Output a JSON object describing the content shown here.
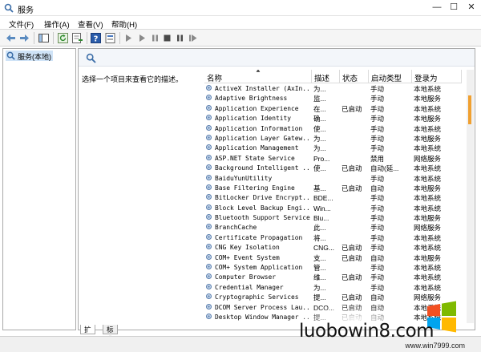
{
  "window": {
    "title": "服务",
    "minimize": "—",
    "maximize": "☐",
    "close": "✕"
  },
  "menu": [
    "文件(F)",
    "操作(A)",
    "查看(V)",
    "帮助(H)"
  ],
  "toolbar": [
    "back-icon",
    "forward-icon",
    "show-hide-tree-icon",
    "refresh-icon",
    "export-list-icon",
    "help-icon",
    "properties-icon",
    "start-service-icon",
    "start-icon",
    "pause-icon",
    "stop-icon",
    "pause-service-icon",
    "restart-icon"
  ],
  "tree": {
    "node_label": "服务(本地)"
  },
  "detail": {
    "description_prompt": "选择一个项目来查看它的描述。"
  },
  "columns": {
    "name": "名称",
    "desc": "描述",
    "status": "状态",
    "startup": "启动类型",
    "logon": "登录为"
  },
  "services": [
    {
      "name": "ActiveX Installer (AxIn...",
      "desc": "为...",
      "status": "",
      "startup": "手动",
      "logon": "本地系统"
    },
    {
      "name": "Adaptive Brightness",
      "desc": "监...",
      "status": "",
      "startup": "手动",
      "logon": "本地服务"
    },
    {
      "name": "Application Experience",
      "desc": "在...",
      "status": "已启动",
      "startup": "手动",
      "logon": "本地系统"
    },
    {
      "name": "Application Identity",
      "desc": "确...",
      "status": "",
      "startup": "手动",
      "logon": "本地服务"
    },
    {
      "name": "Application Information",
      "desc": "使...",
      "status": "",
      "startup": "手动",
      "logon": "本地系统"
    },
    {
      "name": "Application Layer Gatew...",
      "desc": "为...",
      "status": "",
      "startup": "手动",
      "logon": "本地服务"
    },
    {
      "name": "Application Management",
      "desc": "为...",
      "status": "",
      "startup": "手动",
      "logon": "本地系统"
    },
    {
      "name": "ASP.NET State Service",
      "desc": "Pro...",
      "status": "",
      "startup": "禁用",
      "logon": "网络服务"
    },
    {
      "name": "Background Intelligent ...",
      "desc": "使...",
      "status": "已启动",
      "startup": "自动(延...",
      "logon": "本地系统"
    },
    {
      "name": "BaiduYunUtility",
      "desc": "",
      "status": "",
      "startup": "手动",
      "logon": "本地系统"
    },
    {
      "name": "Base Filtering Engine",
      "desc": "基...",
      "status": "已启动",
      "startup": "自动",
      "logon": "本地服务"
    },
    {
      "name": "BitLocker Drive Encrypt...",
      "desc": "BDE...",
      "status": "",
      "startup": "手动",
      "logon": "本地系统"
    },
    {
      "name": "Block Level Backup Engi...",
      "desc": "Win...",
      "status": "",
      "startup": "手动",
      "logon": "本地系统"
    },
    {
      "name": "Bluetooth Support Service",
      "desc": "Blu...",
      "status": "",
      "startup": "手动",
      "logon": "本地服务"
    },
    {
      "name": "BranchCache",
      "desc": "此...",
      "status": "",
      "startup": "手动",
      "logon": "网络服务"
    },
    {
      "name": "Certificate Propagation",
      "desc": "将...",
      "status": "",
      "startup": "手动",
      "logon": "本地系统"
    },
    {
      "name": "CNG Key Isolation",
      "desc": "CNG...",
      "status": "已启动",
      "startup": "手动",
      "logon": "本地系统"
    },
    {
      "name": "COM+ Event System",
      "desc": "支...",
      "status": "已启动",
      "startup": "自动",
      "logon": "本地服务"
    },
    {
      "name": "COM+ System Application",
      "desc": "管...",
      "status": "",
      "startup": "手动",
      "logon": "本地系统"
    },
    {
      "name": "Computer Browser",
      "desc": "维...",
      "status": "已启动",
      "startup": "手动",
      "logon": "本地系统"
    },
    {
      "name": "Credential Manager",
      "desc": "为...",
      "status": "",
      "startup": "手动",
      "logon": "本地系统"
    },
    {
      "name": "Cryptographic Services",
      "desc": "提...",
      "status": "已启动",
      "startup": "自动",
      "logon": "网络服务"
    },
    {
      "name": "DCOM Server Process Lau...",
      "desc": "DCO...",
      "status": "已启动",
      "startup": "自动",
      "logon": "本地系统"
    },
    {
      "name": "Desktop Window Manager ...",
      "desc": "提...",
      "status": "已启动",
      "startup": "自动",
      "logon": "本地系统"
    }
  ],
  "tabs": [
    "扩展",
    "标准"
  ],
  "watermark": {
    "text": "luobowin8.com",
    "url": "www.win7999.com"
  },
  "colors": {
    "tree_selected": "#cfe3f7",
    "scroll_thumb": "#f0a030"
  }
}
